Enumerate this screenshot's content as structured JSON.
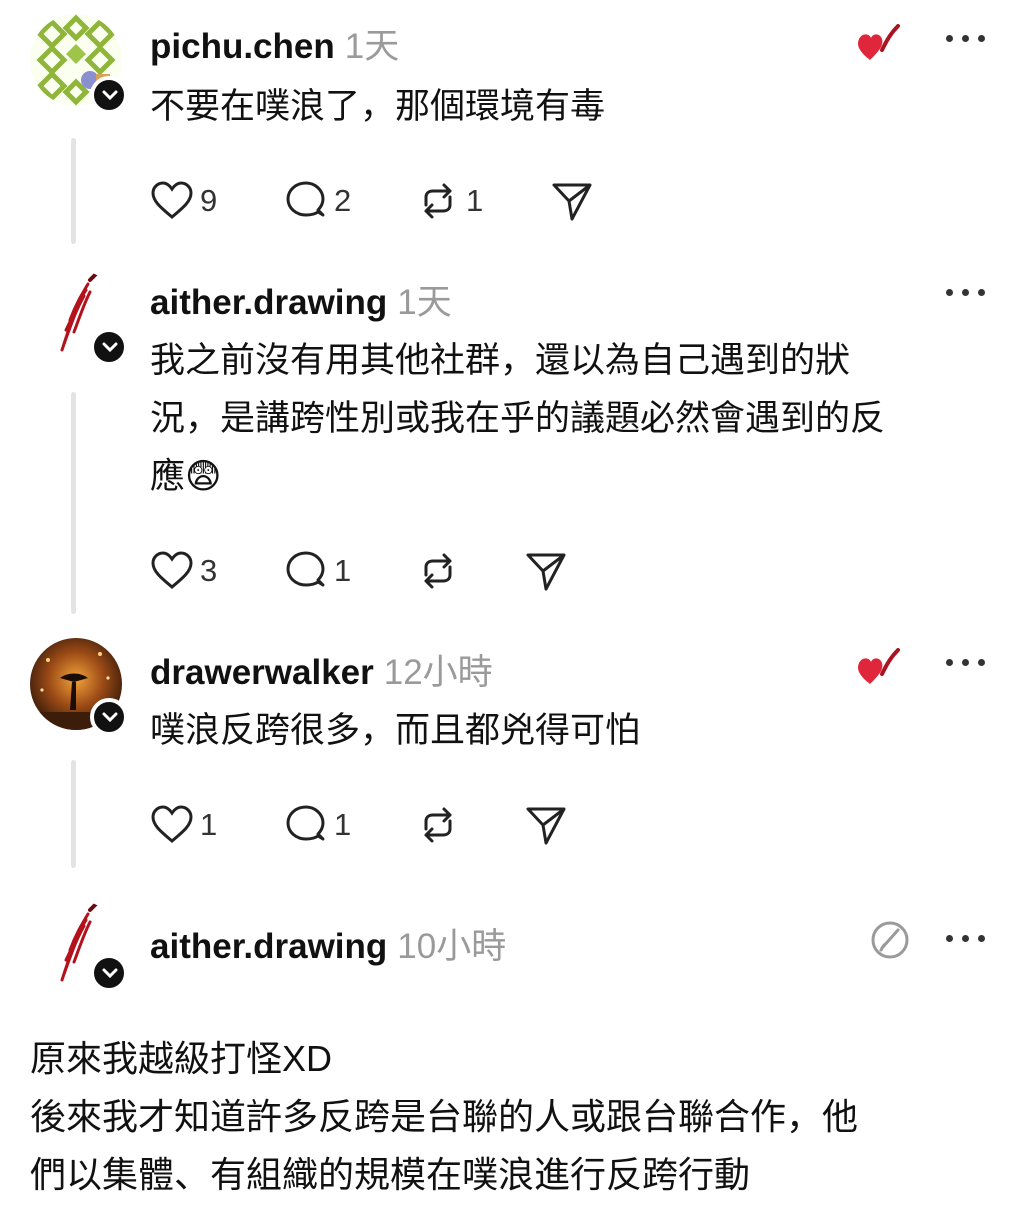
{
  "posts": [
    {
      "username": "pichu.chen",
      "time": "1天",
      "text": [
        "不要在噗浪了，那個環境有毒"
      ],
      "likes": "9",
      "replies": "2",
      "reposts": "1"
    },
    {
      "username": "aither.drawing",
      "time": "1天",
      "text": [
        "我之前沒有用其他社群，還以為自己遇到的狀",
        "況，是講跨性別或我在乎的議題必然會遇到的反",
        "應😨"
      ],
      "likes": "3",
      "replies": "1",
      "reposts": ""
    },
    {
      "username": "drawerwalker",
      "time": "12小時",
      "text": [
        "噗浪反跨很多，而且都兇得可怕"
      ],
      "likes": "1",
      "replies": "1",
      "reposts": ""
    },
    {
      "username": "aither.drawing",
      "time": "10小時",
      "text": [
        "原來我越級打怪XD",
        "後來我才知道許多反跨是台聯的人或跟台聯合作，他",
        "們以集體、有組織的規模在噗浪進行反跨行動"
      ]
    }
  ],
  "colors": {
    "like_red": "#e0263a",
    "muted": "#9a9a9a",
    "text": "#111111"
  },
  "icons": [
    "heart-icon",
    "comment-icon",
    "repost-icon",
    "share-icon",
    "more-icon",
    "chevron-down-icon",
    "edit-icon",
    "liked-by-author-icon"
  ]
}
